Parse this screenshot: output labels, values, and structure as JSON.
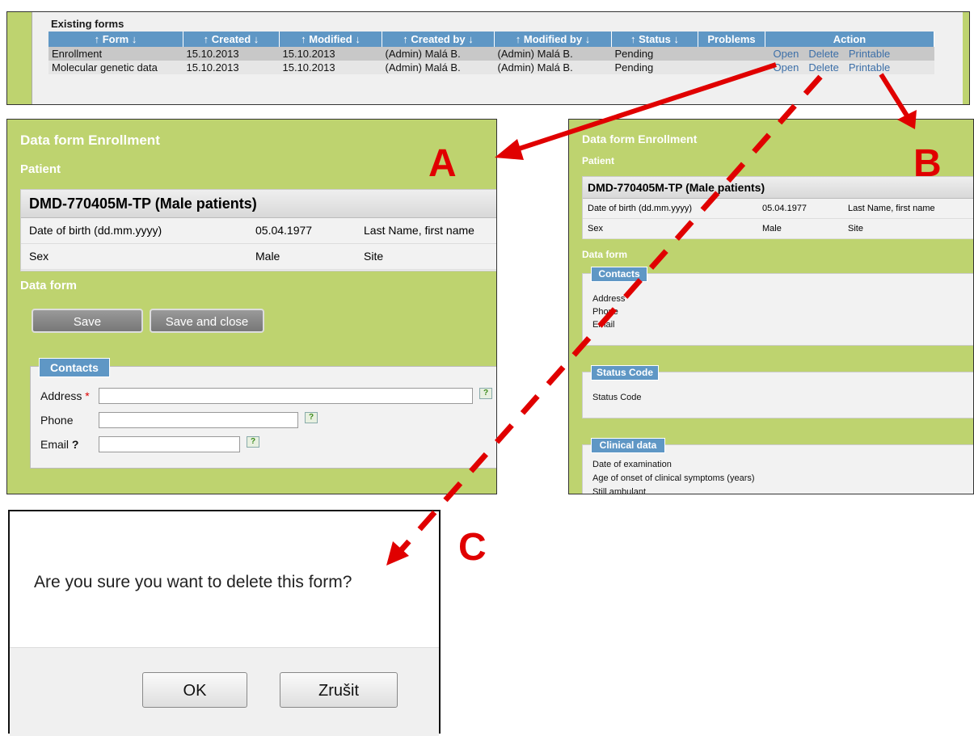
{
  "existing_forms": {
    "title": "Existing forms",
    "columns": [
      "↑ Form ↓",
      "↑ Created ↓",
      "↑ Modified ↓",
      "↑ Created by ↓",
      "↑ Modified by ↓",
      "↑ Status ↓",
      "Problems",
      "Action"
    ],
    "rows": [
      {
        "form": "Enrollment",
        "created": "15.10.2013",
        "modified": "15.10.2013",
        "created_by": "(Admin) Malá B.",
        "modified_by": "(Admin) Malá B.",
        "status": "Pending",
        "problems": ""
      },
      {
        "form": "Molecular genetic data",
        "created": "15.10.2013",
        "modified": "15.10.2013",
        "created_by": "(Admin) Malá B.",
        "modified_by": "(Admin) Malá B.",
        "status": "Pending",
        "problems": ""
      }
    ],
    "actions": {
      "open": "Open",
      "delete": "Delete",
      "printable": "Printable"
    }
  },
  "panel_a": {
    "letter": "A",
    "title": "Data form Enrollment",
    "patient_heading": "Patient",
    "patient_id": "DMD-770405M-TP (Male patients)",
    "dob_label": "Date of birth (dd.mm.yyyy)",
    "dob_value": "05.04.1977",
    "lastname_label": "Last Name, first name",
    "sex_label": "Sex",
    "sex_value": "Male",
    "site_label": "Site",
    "dataform_heading": "Data form",
    "save_label": "Save",
    "save_close_label": "Save and close",
    "contacts_legend": "Contacts",
    "address_label": "Address",
    "required_mark": "*",
    "phone_label": "Phone",
    "email_label": "Email",
    "help_mark": "?"
  },
  "panel_b": {
    "letter": "B",
    "title": "Data form Enrollment",
    "patient_heading": "Patient",
    "patient_id": "DMD-770405M-TP (Male patients)",
    "dob_label": "Date of birth (dd.mm.yyyy)",
    "dob_value": "05.04.1977",
    "lastname_label": "Last Name, first name",
    "sex_label": "Sex",
    "sex_value": "Male",
    "site_label": "Site",
    "dataform_heading": "Data form",
    "contacts_legend": "Contacts",
    "contact_fields": [
      "Address",
      "Phone",
      "Email"
    ],
    "status_legend": "Status Code",
    "status_field": "Status Code",
    "clinical_legend": "Clinical data",
    "clinical_fields": [
      "Date of examination",
      "Age of onset of clinical symptoms (years)",
      "Still ambulant"
    ]
  },
  "panel_c": {
    "letter": "C",
    "message": "Are you sure you want to delete this form?",
    "ok_label": "OK",
    "cancel_label": "Zrušit"
  },
  "colors": {
    "green": "#bed36f",
    "header_blue": "#5f97c5",
    "arrow_red": "#e00000",
    "link_blue": "#3c6fa8"
  }
}
